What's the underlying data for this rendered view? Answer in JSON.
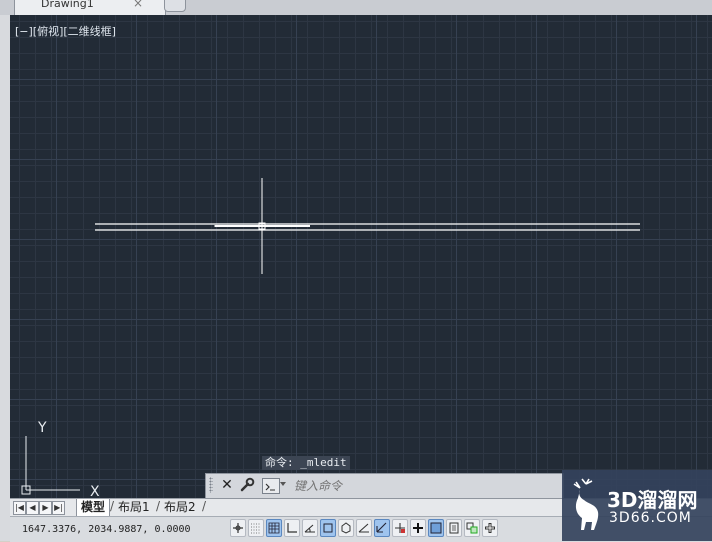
{
  "document_tab": {
    "title": "Drawing1",
    "close_glyph": "×"
  },
  "viewport": {
    "label": "[−][俯视][二维线框]",
    "background": "#222b36",
    "ucs": {
      "x_label": "X",
      "y_label": "Y"
    }
  },
  "command_line": {
    "history": "命令: _mledit",
    "close_glyph": "✕",
    "placeholder": "键入命令"
  },
  "layout_tabs": {
    "nav": [
      "|◀",
      "◀",
      "▶",
      "▶|"
    ],
    "tabs": [
      "模型",
      "布局1",
      "布局2"
    ]
  },
  "status_bar": {
    "coordinates": "1647.3376, 2034.9887, 0.0000"
  },
  "watermark": {
    "text_cn": "3D溜溜网",
    "text_domain": "3D66.COM"
  }
}
